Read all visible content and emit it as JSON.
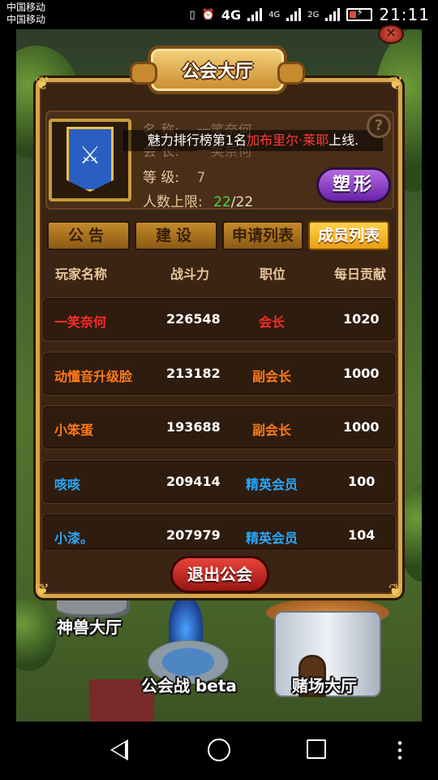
{
  "status_bar": {
    "carrier1": "中国移动",
    "carrier2": "中国移动",
    "net1": "4G",
    "net2": "4G",
    "net3": "2G",
    "time": "21:11"
  },
  "panel": {
    "title": "公会大厅",
    "info": {
      "name_label": "名 称:",
      "name_value": "一笑奈何",
      "leader_label": "会 长:",
      "leader_value": "一笑奈何",
      "level_label": "等   级:",
      "level_value": "7",
      "capacity_label": "人数上限:",
      "capacity_current": "22",
      "capacity_max": "/22"
    },
    "marquee": {
      "prefix": "魅力排行榜第1名",
      "player": "加布里尔·莱耶",
      "suffix": "上线."
    },
    "help_label": "?",
    "shape_button": "塑形",
    "tabs": [
      "公告",
      "建设",
      "申请列表",
      "成员列表"
    ],
    "active_tab": "成员列表",
    "columns": [
      "玩家名称",
      "战斗力",
      "职位",
      "每日贡献"
    ],
    "members": [
      {
        "name": "一笑奈何",
        "power": "226548",
        "position": "会长",
        "contribution": "1020"
      },
      {
        "name": "动懂音升级脸",
        "power": "213182",
        "position": "副会长",
        "contribution": "1000"
      },
      {
        "name": "小笨蛋",
        "power": "193688",
        "position": "副会长",
        "contribution": "1000"
      },
      {
        "name": "咳咳",
        "power": "209414",
        "position": "精英会员",
        "contribution": "100"
      },
      {
        "name": "小漆。",
        "power": "207979",
        "position": "精英会员",
        "contribution": "104"
      }
    ],
    "quit_button": "退出公会"
  },
  "map_labels": {
    "beast_hall": "神兽大厅",
    "guild_war": "公会战 beta",
    "casino": "赌场大厅"
  },
  "colors": {
    "leader": "#ff2a2a",
    "vice_leader": "#ff7a1a",
    "elite": "#2aa8ff",
    "panel_gold": "#d7a64a",
    "panel_bg": "#3a2414"
  }
}
